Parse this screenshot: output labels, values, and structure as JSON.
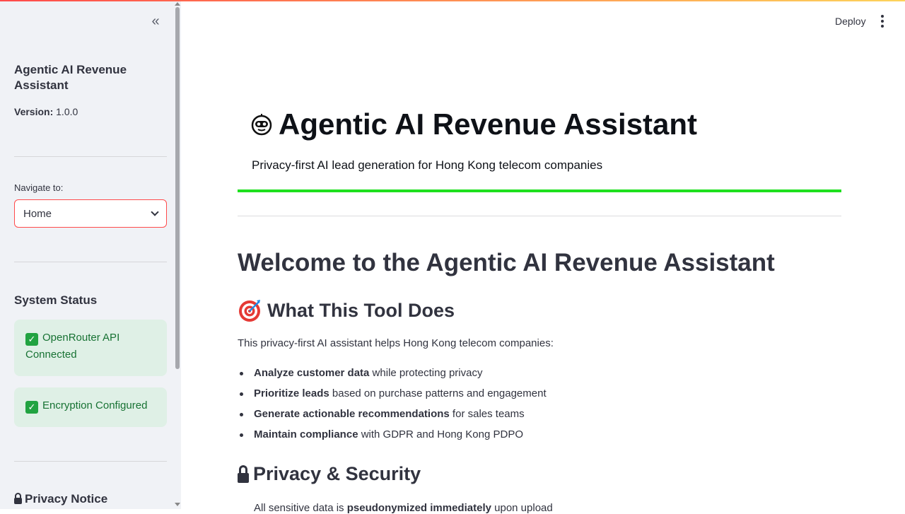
{
  "sidebar": {
    "collapse_symbol": "«",
    "app_title": "Agentic AI Revenue Assistant",
    "version_label": "Version:",
    "version_value": "1.0.0",
    "nav_label": "Navigate to:",
    "nav_selected": "Home",
    "status_heading": "System Status",
    "status_items": [
      {
        "icon": "check-icon",
        "text": "OpenRouter API Connected"
      },
      {
        "icon": "check-icon",
        "text": "Encryption Configured"
      }
    ],
    "privacy_heading": "Privacy Notice"
  },
  "header": {
    "deploy_label": "Deploy"
  },
  "main": {
    "title": "Agentic AI Revenue Assistant",
    "title_icon": "robot-icon",
    "subtitle": "Privacy-first AI lead generation for Hong Kong telecom companies",
    "welcome": "Welcome to the Agentic AI Revenue Assistant",
    "section1": {
      "icon": "target-icon",
      "heading": "What This Tool Does",
      "intro": "This privacy-first AI assistant helps Hong Kong telecom companies:",
      "bullets": [
        {
          "bold": "Analyze customer data",
          "rest": " while protecting privacy"
        },
        {
          "bold": "Prioritize leads",
          "rest": " based on purchase patterns and engagement"
        },
        {
          "bold": "Generate actionable recommendations",
          "rest": " for sales teams"
        },
        {
          "bold": "Maintain compliance",
          "rest": " with GDPR and Hong Kong PDPO"
        }
      ]
    },
    "section2": {
      "icon": "lock-icon",
      "heading": "Privacy & Security",
      "first_line": {
        "before": "All sensitive data is ",
        "bold": "pseudonymized immediately",
        "after": " upon upload"
      }
    }
  },
  "colors": {
    "accent": "#ff4b4b",
    "success_bg": "#dff0e6",
    "success_text": "#177233",
    "divider_green": "#1fe01f",
    "sidebar_bg": "#f0f2f6"
  }
}
